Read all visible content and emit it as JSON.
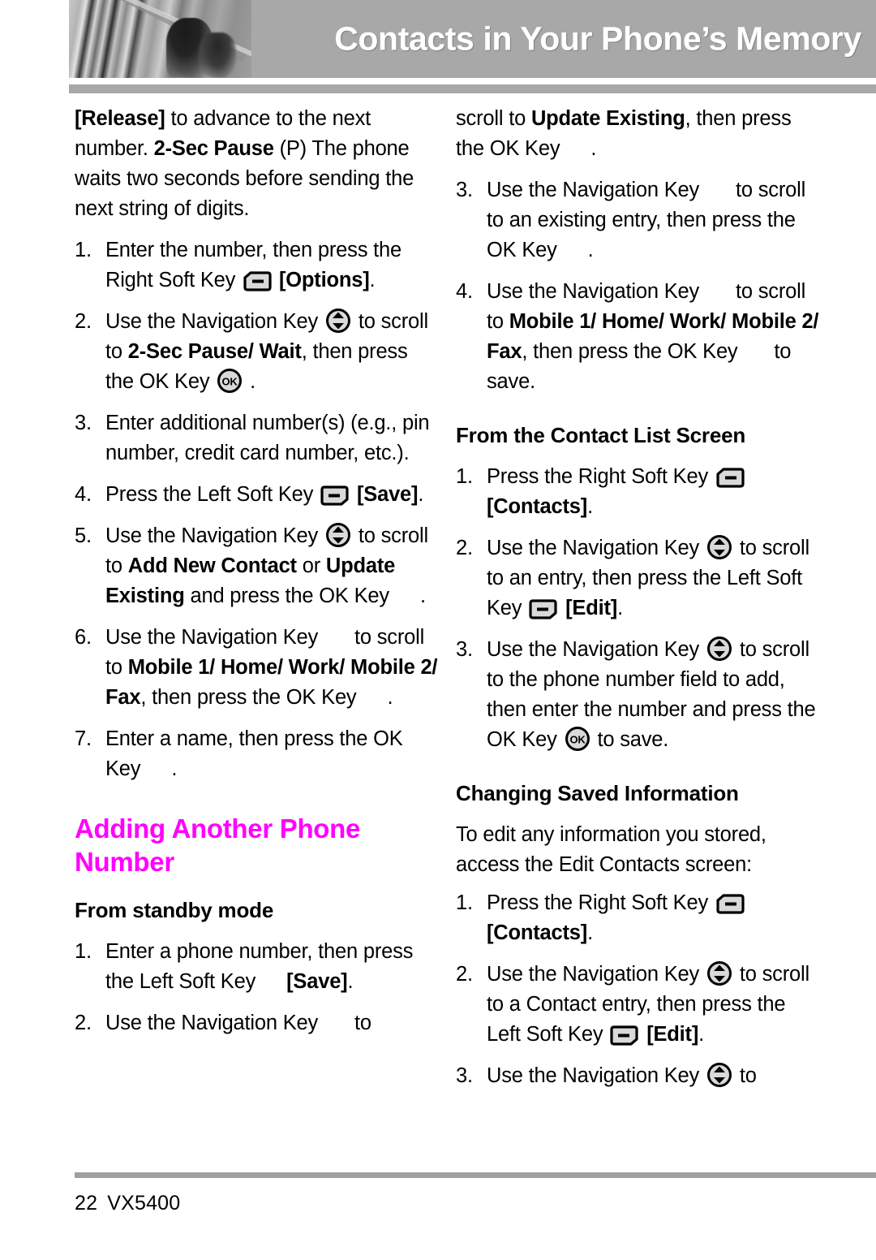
{
  "header": {
    "title": "Contacts in Your Phone’s Memory",
    "photo_alt": "grayscale-photo"
  },
  "icons": {
    "right_soft_key": "right-soft-key-icon",
    "left_soft_key": "left-soft-key-icon",
    "navigation_key": "navigation-key-icon",
    "ok_key": "ok-key-icon",
    "ok_label": "OK"
  },
  "colors": {
    "heading_accent": "#ff00ff",
    "header_band": "#a8a8a8",
    "footer_rule": "#a0a0a0",
    "icon_fill": "#d9d9d9"
  },
  "left_column": {
    "intro": {
      "part1_bold": "[Release]",
      "part2": " to advance to the next number. ",
      "part3_bold": "2-Sec Pause",
      "part4": " (P) The phone waits two seconds before sending the next string of digits."
    },
    "steps": [
      {
        "num": "1.",
        "seg_a": "Enter the number, then press the Right Soft Key ",
        "icon": "right-soft-key-icon",
        "seg_b": " ",
        "bold_b": "[Options]",
        "seg_c": "."
      },
      {
        "num": "2.",
        "seg_a": "Use the Navigation Key ",
        "icon": "navigation-key-icon",
        "seg_b": " to scroll to ",
        "bold_b": "2-Sec Pause/ Wait",
        "seg_c": ", then press the OK Key ",
        "icon2": "ok-key-icon",
        "seg_d": " ."
      },
      {
        "num": "3.",
        "seg_a": "Enter additional number(s) (e.g., pin number, credit card number, etc.)."
      },
      {
        "num": "4.",
        "seg_a": "Press the Left Soft Key ",
        "icon": "left-soft-key-icon",
        "seg_b": " ",
        "bold_b": "[Save]",
        "seg_c": "."
      },
      {
        "num": "5.",
        "seg_a": "Use the Navigation Key ",
        "icon": "navigation-key-icon",
        "seg_b": " to scroll to ",
        "bold_b": "Add New Contact",
        "seg_c": " or ",
        "bold_c": "Update Existing",
        "seg_d": " and press the OK Key",
        "seg_e": "."
      },
      {
        "num": "6.",
        "seg_a": "Use the Navigation Key",
        "seg_b": " to scroll to ",
        "bold_b": "Mobile 1/ Home/ Work/ Mobile 2/ Fax",
        "seg_c": ", then press the OK Key",
        "seg_d": "."
      },
      {
        "num": "7.",
        "seg_a": "Enter a name, then press the OK Key",
        "seg_b": "."
      }
    ],
    "section_heading": "Adding Another Phone Number",
    "sub_heading": "From standby mode",
    "standby_steps": [
      {
        "num": "1.",
        "seg_a": "Enter a phone number, then press the Left Soft Key",
        "bold_b": "[Save]",
        "seg_c": "."
      },
      {
        "num": "2.",
        "seg_a": "Use the Navigation Key",
        "seg_b": " to"
      }
    ]
  },
  "right_column": {
    "continued": {
      "seg_a": "scroll to ",
      "bold_a": "Update Existing",
      "seg_b": ", then press the OK Key",
      "seg_c": "."
    },
    "steps": [
      {
        "num": "3.",
        "seg_a": "Use the Navigation Key",
        "seg_b": " to scroll to an existing entry, then press the OK Key",
        "seg_c": "."
      },
      {
        "num": "4.",
        "seg_a": "Use the Navigation Key",
        "seg_b": " to scroll to ",
        "bold_b": "Mobile 1/ Home/ Work/ Mobile 2/ Fax",
        "seg_c": ", then press the OK Key",
        "seg_d": " to save."
      }
    ],
    "contact_list_heading": "From the Contact List Screen",
    "contact_list_steps": [
      {
        "num": "1.",
        "seg_a": "Press the Right Soft Key ",
        "icon": "right-soft-key-icon",
        "seg_b": " ",
        "bold_b": "[Contacts]",
        "seg_c": "."
      },
      {
        "num": "2.",
        "seg_a": "Use the Navigation Key ",
        "icon": "navigation-key-icon",
        "seg_b": " to scroll to an entry, then press the Left Soft Key ",
        "icon2": "left-soft-key-icon",
        "seg_c": " ",
        "bold_c": "[Edit]",
        "seg_d": "."
      },
      {
        "num": "3.",
        "seg_a": "Use the Navigation Key ",
        "icon": "navigation-key-icon",
        "seg_b": " to scroll to the phone number field to add, then enter the number and press the OK Key ",
        "icon2": "ok-key-icon",
        "seg_c": " to save."
      }
    ],
    "changing_heading": "Changing Saved Information",
    "changing_intro": "To edit any information you stored, access the Edit Contacts screen:",
    "changing_steps": [
      {
        "num": "1.",
        "seg_a": "Press the Right Soft Key ",
        "icon": "right-soft-key-icon",
        "seg_b": " ",
        "bold_b": "[Contacts]",
        "seg_c": "."
      },
      {
        "num": "2.",
        "seg_a": "Use the Navigation Key ",
        "icon": "navigation-key-icon",
        "seg_b": " to scroll to a Contact entry, then press the Left Soft Key ",
        "icon2": "left-soft-key-icon",
        "seg_c": " ",
        "bold_c": "[Edit]",
        "seg_d": "."
      },
      {
        "num": "3.",
        "seg_a": "Use the Navigation Key ",
        "icon": "navigation-key-icon",
        "seg_b": " to"
      }
    ]
  },
  "footer": {
    "page_number": "22",
    "model": "VX5400"
  }
}
